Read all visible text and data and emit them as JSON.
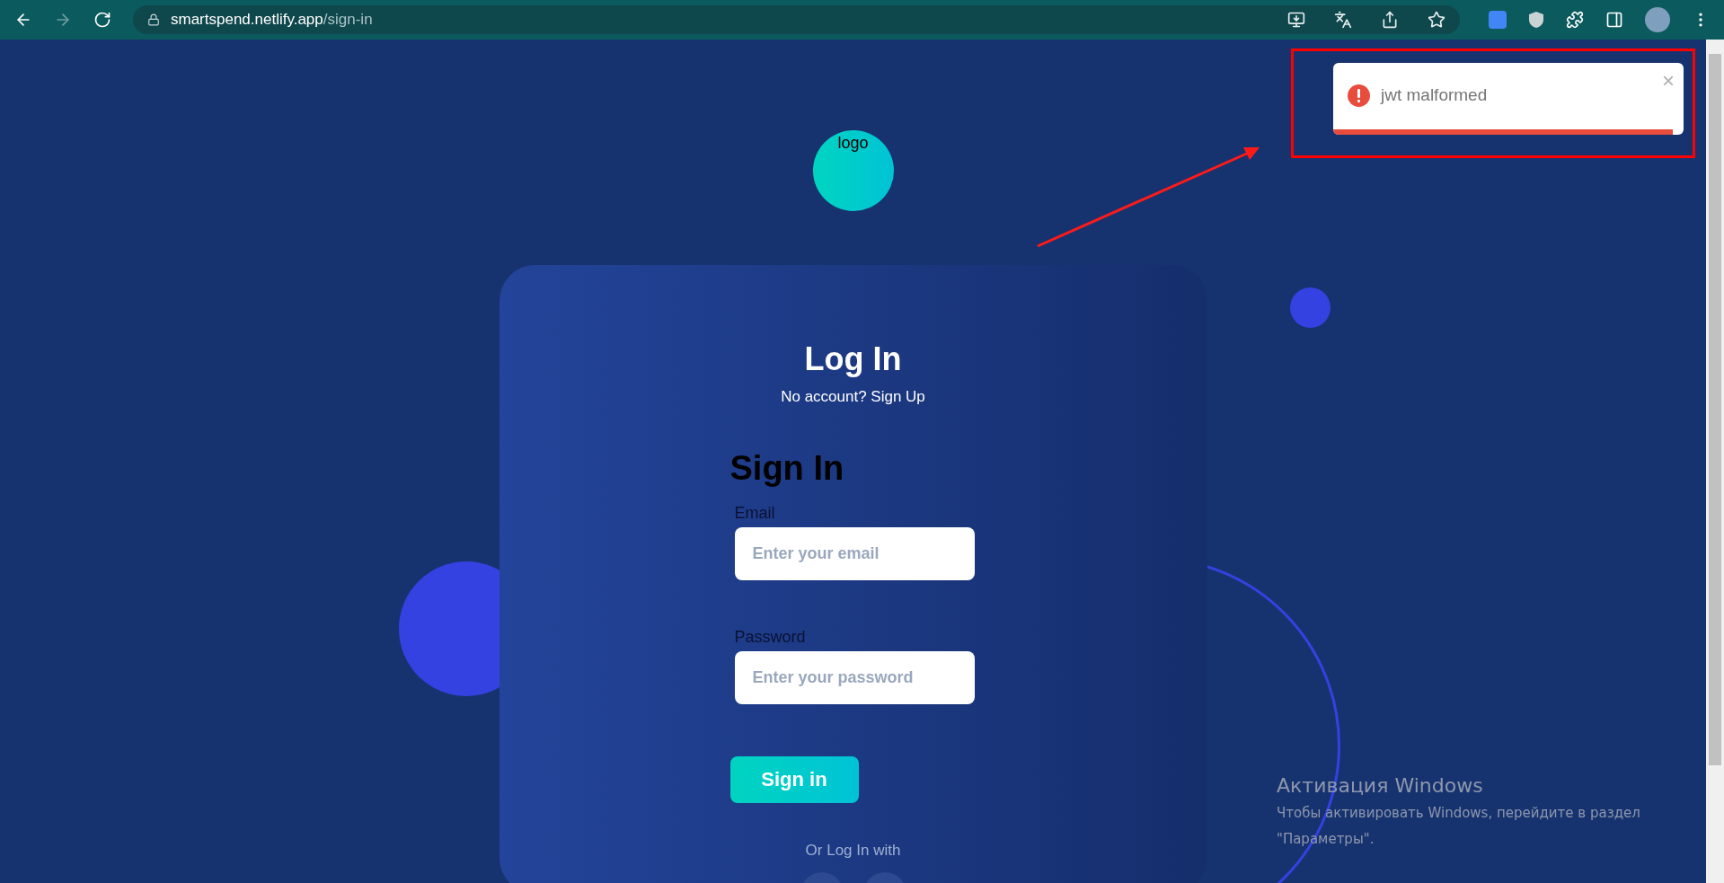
{
  "browser": {
    "url_host": "smartspend.netlify.app",
    "url_path": "/sign-in",
    "forward_disabled": true
  },
  "toast": {
    "message": "jwt malformed",
    "close": "×",
    "level": 0.97
  },
  "logo": {
    "alt": "logo"
  },
  "card": {
    "title": "Log In",
    "subtitle": "No account? Sign Up"
  },
  "form": {
    "title": "Sign In",
    "fields": [
      {
        "label": "Email",
        "placeholder": "Enter your email"
      },
      {
        "label": "Password",
        "placeholder": "Enter your password"
      }
    ],
    "submit": "Sign in",
    "alt_login": "Or Log In with"
  },
  "windows_activation": {
    "title": "Активация Windows",
    "message": "Чтобы активировать Windows, перейдите в раздел \"Параметры\"."
  }
}
